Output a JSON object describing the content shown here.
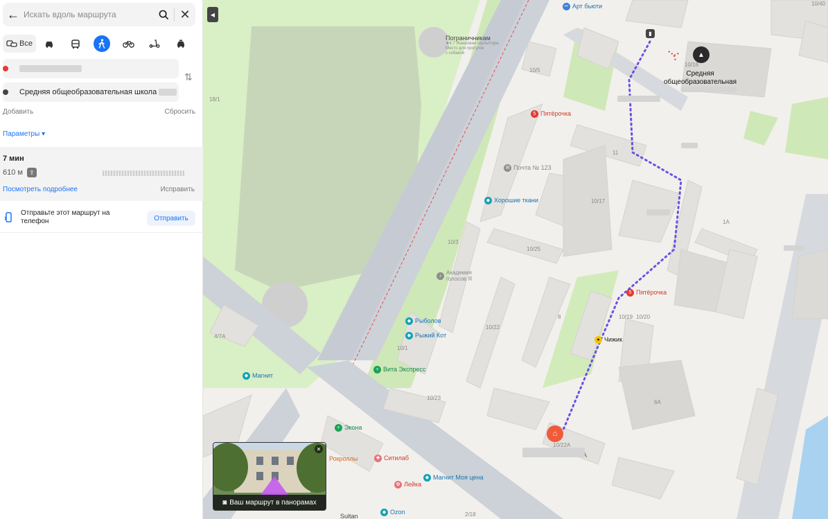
{
  "search": {
    "placeholder": "Искать вдоль маршрута",
    "back_icon": "arrow-left-icon",
    "close_icon": "close-icon"
  },
  "modes": {
    "all_label": "Все",
    "items": [
      "car",
      "bus",
      "walk",
      "bicycle",
      "scooter",
      "taxi"
    ],
    "active": "walk"
  },
  "route": {
    "start": {
      "color": "#e53935"
    },
    "destination": {
      "label": "Средняя общеобразовательная школа",
      "color": "#444444"
    },
    "add_label": "Добавить",
    "reset_label": "Сбросить",
    "params_label": "Параметры ▾"
  },
  "summary": {
    "time": "7 мин",
    "distance": "610 м",
    "details_label": "Посмотреть подробнее",
    "fix_label": "Исправить"
  },
  "send": {
    "text": "Отправьте этот маршрут на телефон",
    "button": "Отправить"
  },
  "map": {
    "colors": {
      "route": "#6d4fe3",
      "park": "#c9e8b0",
      "road": "#c7cbd3",
      "building": "#e2e0dc"
    },
    "labels": {
      "art_beauty": "Арт бьюти",
      "pogranichnikam": "Пограничникам",
      "pogr_sub": "★4,7 Жанровая скульптура",
      "pogr_sub2": "Место для прогулок",
      "pogr_sub3": "с собакой",
      "pyaterochka1": "Пятёрочка",
      "pyaterochka2": "Пятёрочка",
      "school": "Средняя",
      "school2": "общеобразовательная",
      "postoffice": "Почта № 123",
      "horoshie_tkani": "Хорошие ткани",
      "akademia": "Академия",
      "akademia2": "голосов Я",
      "rybolov": "Рыболов",
      "ryzhiy_kot": "Рыжий Кот",
      "vita": "Вита Экспресс",
      "magnit": "Магнит",
      "chizhik": "Чижик",
      "ekona": "Экона",
      "rokrolly": "Рокроллы",
      "sitilab": "Ситилаб",
      "leika": "Лейка",
      "magnit_moya": "Магнит Моя цена",
      "sultan": "Sultan",
      "ozon": "Ozon",
      "panorama": "Ваш маршрут в панорамах"
    },
    "house_numbers": [
      "10/5",
      "18/1",
      "11",
      "10/17",
      "10/3",
      "10/25",
      "10/1",
      "10/22",
      "8",
      "10/20",
      "6А",
      "1А",
      "4/7А",
      "10/22А",
      "2А",
      "10/23",
      "10/19",
      "2/18",
      "10/40",
      "10/16"
    ]
  }
}
